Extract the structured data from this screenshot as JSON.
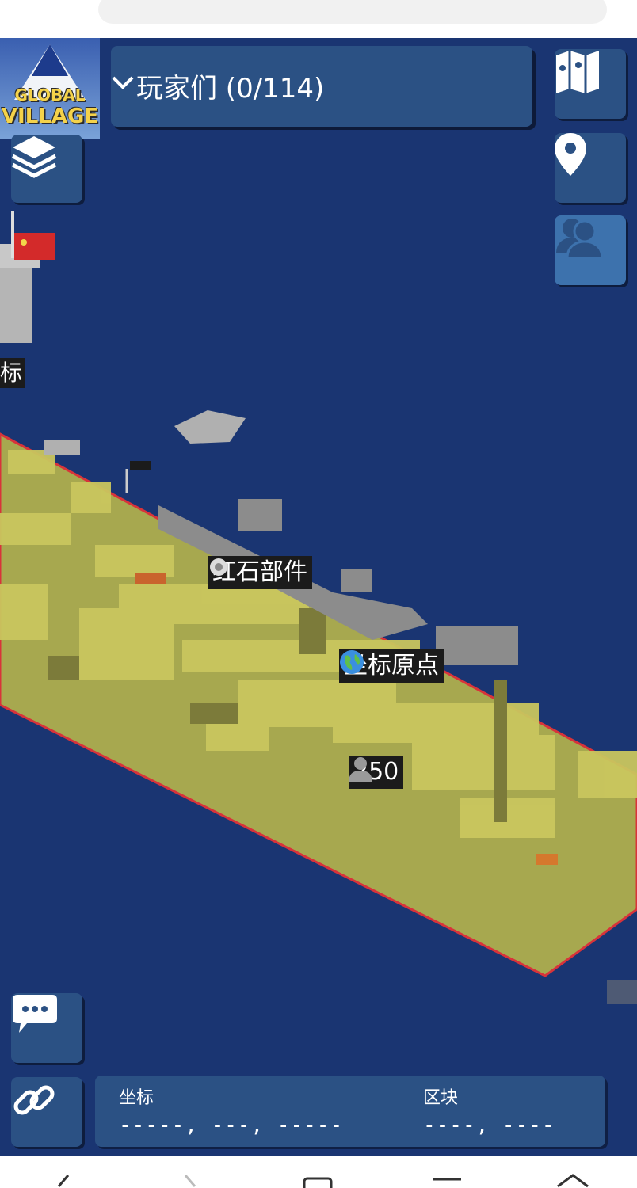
{
  "players": {
    "label": "玩家们 (0/114)"
  },
  "logo": {
    "line1": "GLOBAL",
    "line2": "VILLAGE"
  },
  "markers": {
    "redstone": "红石部件",
    "origin": "坐标原点",
    "player_count": "250",
    "partial": "标"
  },
  "coords": {
    "coord_label": "坐标",
    "coord_value": "-----, ---, -----",
    "chunk_label": "区块",
    "chunk_value": "----, ----"
  },
  "icons": {
    "layers": "layers-icon",
    "map": "map-icon",
    "location": "location-pin-icon",
    "players": "players-icon",
    "chat": "chat-icon",
    "link": "link-icon"
  },
  "colors": {
    "ocean": "#1a3572",
    "panel": "#2b5184",
    "panel_active": "#3d72ad",
    "claim_fill": "#a7a84f",
    "claim_border": "#d8333a"
  }
}
